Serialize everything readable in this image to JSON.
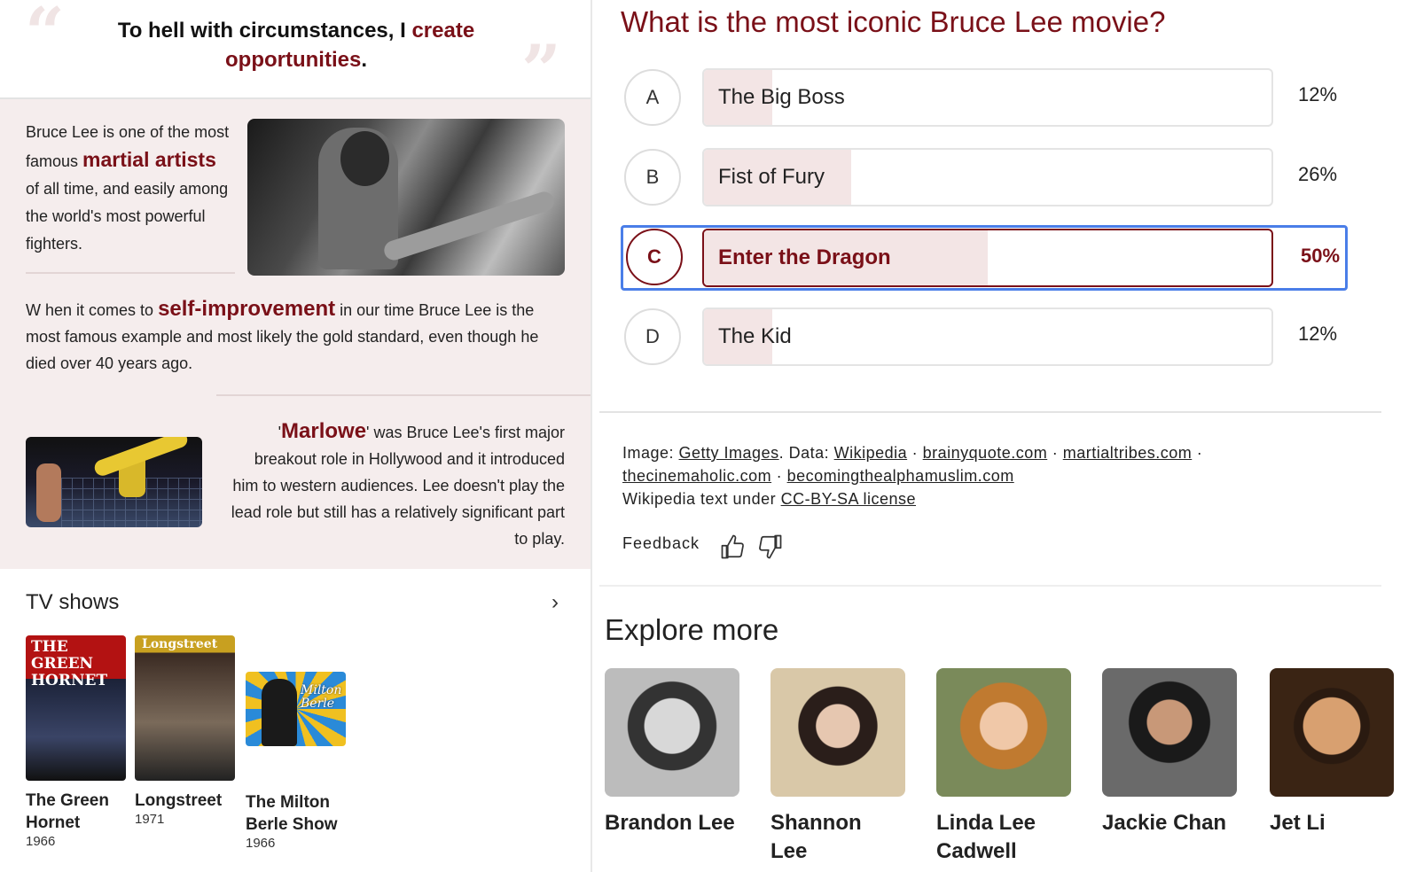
{
  "quote": {
    "part1": "To hell with circumstances, I ",
    "highlight": "create opportunities",
    "part2": "."
  },
  "intro": {
    "p1_a": "Bruce Lee is one of the most famous ",
    "p1_highlight": "martial artists",
    "p1_b": " of all time, and easily among the world's most powerful fighters.",
    "p2_a": "W hen it comes to ",
    "p2_highlight": "self-improvement",
    "p2_b": " in our time Bruce Lee is the most famous example and most likely the gold standard, even though he died over 40 years ago.",
    "p3_a": "'",
    "p3_highlight": "Marlowe",
    "p3_b": "' was Bruce Lee's first major breakout role in Hollywood and it introduced him to western audiences. Lee doesn't play the lead role but still has a relatively significant part to play."
  },
  "tv_shows": {
    "title": "TV shows",
    "arrow": "›",
    "items": [
      {
        "title_line1": "The Green",
        "title_line2": "Hornet",
        "year": "1966",
        "poster_text1": "THE GREEN",
        "poster_text2": "HORNET"
      },
      {
        "title_line1": "Longstreet",
        "title_line2": "",
        "year": "1971",
        "poster_text1": "Longstreet",
        "poster_text2": ""
      },
      {
        "title_line1": "The Milton",
        "title_line2": "Berle Show",
        "year": "1966",
        "poster_text1": "Milton",
        "poster_text2": "Berle"
      }
    ]
  },
  "poll": {
    "question": "What is the most iconic Bruce Lee movie?",
    "options": [
      {
        "letter": "A",
        "label": "The Big Boss",
        "percent": "12%",
        "share": 0.12
      },
      {
        "letter": "B",
        "label": "Fist of Fury",
        "percent": "26%",
        "share": 0.26
      },
      {
        "letter": "C",
        "label": "Enter the Dragon",
        "percent": "50%",
        "share": 0.5
      },
      {
        "letter": "D",
        "label": "The Kid",
        "percent": "12%",
        "share": 0.12
      }
    ],
    "selected": "C"
  },
  "attribution": {
    "image_label": "Image: ",
    "image_source": "Getty Images",
    "data_label": ". Data: ",
    "sources": [
      "Wikipedia",
      "brainyquote.com",
      "martialtribes.com",
      "thecinemaholic.com",
      "becomingthealphamuslim.com"
    ],
    "sep": " · ",
    "license_text": "Wikipedia text under ",
    "license_link": "CC-BY-SA license"
  },
  "feedback": {
    "label": "Feedback",
    "like_icon": "thumbs-up-icon",
    "dislike_icon": "thumbs-down-icon"
  },
  "explore": {
    "title": "Explore more",
    "people": [
      {
        "name_line1": "Brandon Lee",
        "name_line2": ""
      },
      {
        "name_line1": "Shannon",
        "name_line2": "Lee"
      },
      {
        "name_line1": "Linda Lee",
        "name_line2": "Cadwell"
      },
      {
        "name_line1": "Jackie Chan",
        "name_line2": ""
      },
      {
        "name_line1": "Jet Li",
        "name_line2": ""
      }
    ]
  },
  "colors": {
    "accent": "#7a1018",
    "selected_outline": "#4a7ee8",
    "section_bg": "#f5eded",
    "bar_fill": "#f3e5e5"
  }
}
